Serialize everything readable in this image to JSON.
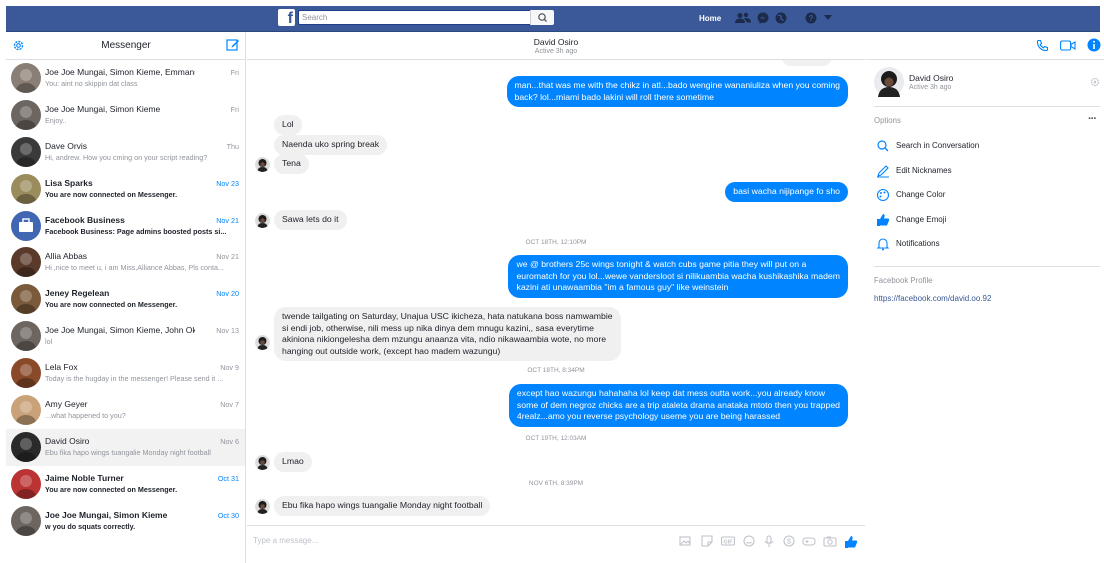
{
  "topbar": {
    "logo": "f",
    "search_placeholder": "Search",
    "home_label": "Home",
    "icons": [
      "friends-icon",
      "messenger-icon",
      "globe-icon",
      "help-icon",
      "dropdown-caret-icon"
    ]
  },
  "sidebar": {
    "title": "Messenger",
    "conversations": [
      {
        "name": "Joe Joe Mungai, Simon Kieme, Emmanuel Savi...",
        "snippet": "You: aint no skippin dat class",
        "date": "Fri",
        "unread": false,
        "avatar": "#8a7f76"
      },
      {
        "name": "Joe Joe Mungai, Simon Kieme",
        "snippet": "Enjoy..",
        "date": "Fri",
        "unread": false,
        "avatar": "#6d6560"
      },
      {
        "name": "Dave Orvis",
        "snippet": "Hi, andrew. How you cming on your script reading?",
        "date": "Thu",
        "unread": false,
        "avatar": "#3a3a3a"
      },
      {
        "name": "Lisa Sparks",
        "snippet": "You are now connected on Messenger.",
        "date": "Nov 23",
        "unread": true,
        "avatar": "#9a8c5c"
      },
      {
        "name": "Facebook Business",
        "snippet": "Facebook Business: Page admins boosted posts si...",
        "date": "Nov 21",
        "unread": true,
        "avatar": "#4267b2"
      },
      {
        "name": "Allia Abbas",
        "snippet": "Hi ,nice to meet u, i am Miss,Alliance Abbas, Pls conta...",
        "date": "Nov 21",
        "unread": false,
        "avatar": "#5a3a2a"
      },
      {
        "name": "Jeney Regelean",
        "snippet": "You are now connected on Messenger.",
        "date": "Nov 20",
        "unread": true,
        "avatar": "#7a5a3a"
      },
      {
        "name": "Joe Joe Mungai, Simon Kieme, John Okello",
        "snippet": "lol",
        "date": "Nov 13",
        "unread": false,
        "avatar": "#6d6560"
      },
      {
        "name": "Lela Fox",
        "snippet": "Today is the hugday in the messenger! Please send it ...",
        "date": "Nov 9",
        "unread": false,
        "avatar": "#8a4a2a"
      },
      {
        "name": "Amy Geyer",
        "snippet": "...what happened to you?",
        "date": "Nov 7",
        "unread": false,
        "avatar": "#c9a27a"
      },
      {
        "name": "David Osiro",
        "snippet": "Ebu fika hapo wings tuangalie Monday night football",
        "date": "Nov 6",
        "unread": false,
        "avatar": "#2a2a2a",
        "active": true
      },
      {
        "name": "Jaime Noble Turner",
        "snippet": "You are now connected on Messenger.",
        "date": "Oct 31",
        "unread": true,
        "avatar": "#b33"
      },
      {
        "name": "Joe Joe Mungai, Simon Kieme",
        "snippet": "w you do squats correctly.",
        "date": "Oct 30",
        "unread": true,
        "avatar": "#6d6560"
      }
    ]
  },
  "chat": {
    "name": "David Osiro",
    "status": "Active 3h ago",
    "composer_placeholder": "Type a message...",
    "messages": [
      {
        "kind": "out",
        "text": "man...that was me with the chikz in atl...bado wengine wananiuliza when you coming\nback? lol...miami bado lakini will roll there sometime"
      },
      {
        "kind": "in",
        "text": "Lol"
      },
      {
        "kind": "in",
        "text": "Naenda uko spring break"
      },
      {
        "kind": "in",
        "text": "Tena"
      },
      {
        "kind": "out",
        "text": "basi wacha nijipange fo sho"
      },
      {
        "kind": "in",
        "text": "Sawa lets do it"
      },
      {
        "kind": "ts",
        "text": "OCT 18TH, 12:10PM"
      },
      {
        "kind": "out",
        "text": "we @ brothers 25c wings tonight & watch cubs game pitia they will put on a\neuromatch for you lol...wewe vandersloot si nilikuambia wacha kushikashika madem\nkazini ati unawaambia \"im a famous guy\" like weinstein"
      },
      {
        "kind": "in",
        "text": "twende tailgating on Saturday, Unajua USC ikicheza, hata natukana boss namwambie\nsi endi job, otherwise, nili mess up nika dinya dem mnugu kazini,, sasa everytime\nakiniona nikiongelesha dem mzungu anaanza vita, ndio nikawaambia wote, no more\nhanging out outside work, (except hao madem wazungu)"
      },
      {
        "kind": "ts",
        "text": "OCT 18TH, 8:34PM"
      },
      {
        "kind": "out",
        "text": "except hao wazungu hahahaha lol keep dat mess outta work...you already know\nsome of dem negroz chicks are a trip ataleta drama anataka mtoto then you trapped\n4realz...amo you reverse psychology useme you are being harassed"
      },
      {
        "kind": "ts",
        "text": "OCT 19TH, 12:03AM"
      },
      {
        "kind": "in",
        "text": "Lmao"
      },
      {
        "kind": "ts",
        "text": "NOV 6TH, 8:39PM"
      },
      {
        "kind": "in",
        "text": "Ebu fika hapo wings tuangalie Monday night football"
      }
    ]
  },
  "info_panel": {
    "name": "David Osiro",
    "status": "Active 3h ago",
    "options_title": "Options",
    "options": [
      {
        "label": "Search in Conversation",
        "icon": "search-icon"
      },
      {
        "label": "Edit Nicknames",
        "icon": "pencil-icon"
      },
      {
        "label": "Change Color",
        "icon": "palette-icon"
      },
      {
        "label": "Change Emoji",
        "icon": "thumbs-up-icon"
      },
      {
        "label": "Notifications",
        "icon": "bell-icon"
      }
    ],
    "profile_title": "Facebook Profile",
    "profile_link": "https://facebook.com/david.oo.92"
  },
  "colors": {
    "accent": "#0084ff",
    "brand": "#3b5998",
    "bubble_in": "#f1f0f0"
  }
}
